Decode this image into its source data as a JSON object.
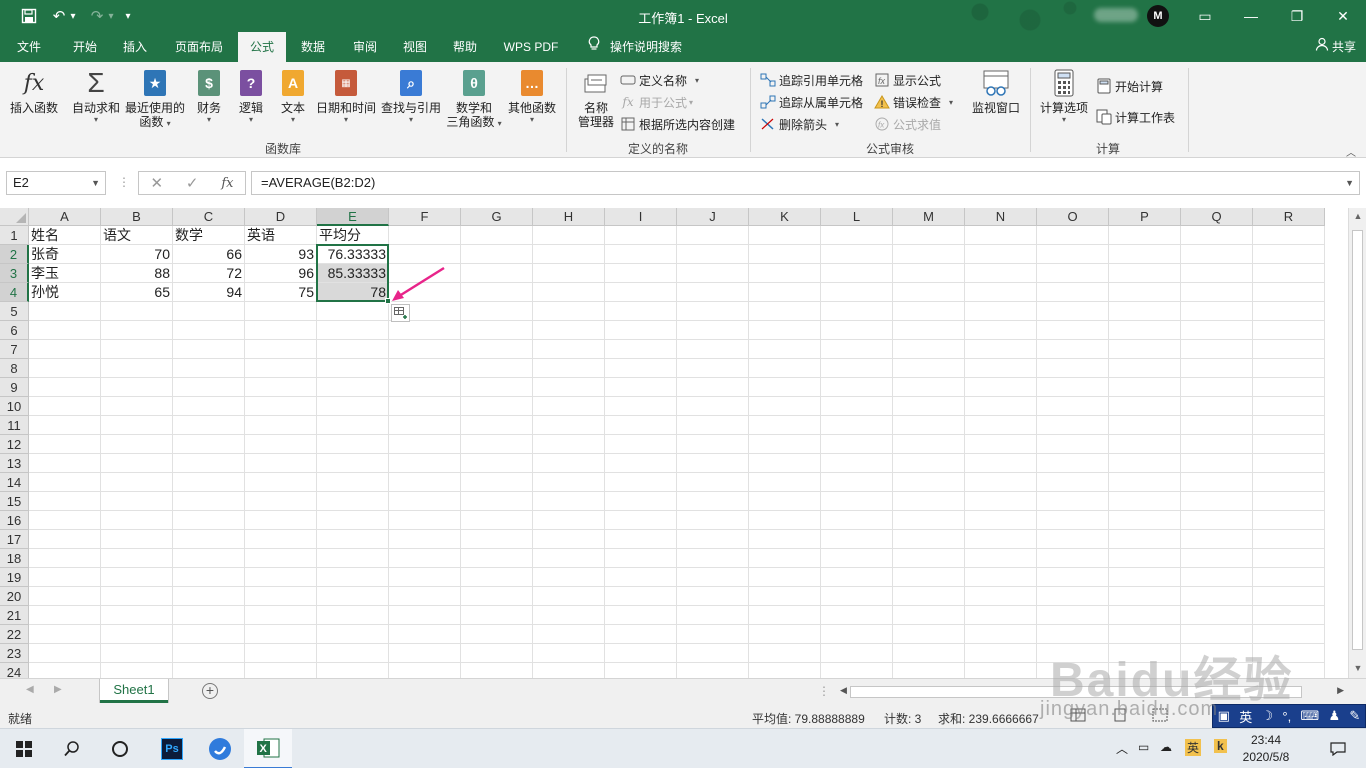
{
  "window": {
    "title": "工作簿1  -  Excel",
    "account_initial": "M",
    "minimize": "—",
    "restore": "❐",
    "close": "✕",
    "ribbon_display": "▭"
  },
  "quick_access": {
    "save": "💾",
    "undo": "↶",
    "undo_dd": "▾",
    "redo": "↷",
    "redo_dd": "▾",
    "customize": "▾"
  },
  "tabs": [
    "文件",
    "开始",
    "插入",
    "页面布局",
    "公式",
    "数据",
    "审阅",
    "视图",
    "帮助",
    "WPS PDF",
    "操作说明搜索"
  ],
  "active_tab": "公式",
  "share_label": "共享",
  "ribbon": {
    "function_library": {
      "label": "函数库",
      "insert_function": "插入函数",
      "autosum": "自动求和",
      "recent_1": "最近使用的",
      "recent_2": "函数",
      "financial": "财务",
      "logical": "逻辑",
      "text": "文本",
      "datetime": "日期和时间",
      "lookup": "查找与引用",
      "math_1": "数学和",
      "math_2": "三角函数",
      "more": "其他函数"
    },
    "defined_names": {
      "label": "定义的名称",
      "name_manager_1": "名称",
      "name_manager_2": "管理器",
      "define_name": "定义名称",
      "use_in_formula": "用于公式",
      "create_from_selection": "根据所选内容创建"
    },
    "formula_auditing": {
      "label": "公式审核",
      "trace_precedents": "追踪引用单元格",
      "trace_dependents": "追踪从属单元格",
      "remove_arrows": "删除箭头",
      "show_formulas": "显示公式",
      "error_checking": "错误检查",
      "evaluate_formula": "公式求值",
      "watch_window": "监视窗口"
    },
    "calculation": {
      "label": "计算",
      "options": "计算选项",
      "calc_now": "开始计算",
      "calc_sheet": "计算工作表"
    }
  },
  "formula_bar": {
    "name_box": "E2",
    "formula": "=AVERAGE(B2:D2)",
    "cancel": "✕",
    "enter": "✓",
    "fx": "fx"
  },
  "grid": {
    "columns": [
      "A",
      "B",
      "C",
      "D",
      "E",
      "F",
      "G",
      "H",
      "I",
      "J",
      "K",
      "L",
      "M",
      "N",
      "O",
      "P",
      "Q",
      "R"
    ],
    "rows": [
      "1",
      "2",
      "3",
      "4",
      "5",
      "6",
      "7",
      "8",
      "9",
      "10",
      "11",
      "12",
      "13",
      "14",
      "15",
      "16",
      "17",
      "18",
      "19",
      "20",
      "21",
      "22",
      "23",
      "24"
    ],
    "cells": {
      "A1": "姓名",
      "B1": "语文",
      "C1": "数学",
      "D1": "英语",
      "E1": "平均分",
      "A2": "张奇",
      "B2": "70",
      "C2": "66",
      "D2": "93",
      "E2": "76.33333",
      "A3": "李玉",
      "B3": "88",
      "C3": "72",
      "D3": "96",
      "E3": "85.33333",
      "A4": "孙悦",
      "B4": "65",
      "C4": "94",
      "D4": "75",
      "E4": "78"
    }
  },
  "sheets": [
    "Sheet1"
  ],
  "status": {
    "ready": "就绪",
    "average": "平均值: 79.88888889",
    "count": "计数: 3",
    "sum": "求和: 239.6666667"
  },
  "ime": {
    "mode": "英"
  },
  "taskbar": {
    "time": "23:44",
    "date": "2020/5/8",
    "ps_label": "Ps",
    "ime_tray": "英"
  },
  "watermark": {
    "brand": "Baidu经验",
    "url": "jingyan.baidu.com"
  },
  "colors": {
    "excel_green": "#217346",
    "arrow": "#e8248a"
  }
}
